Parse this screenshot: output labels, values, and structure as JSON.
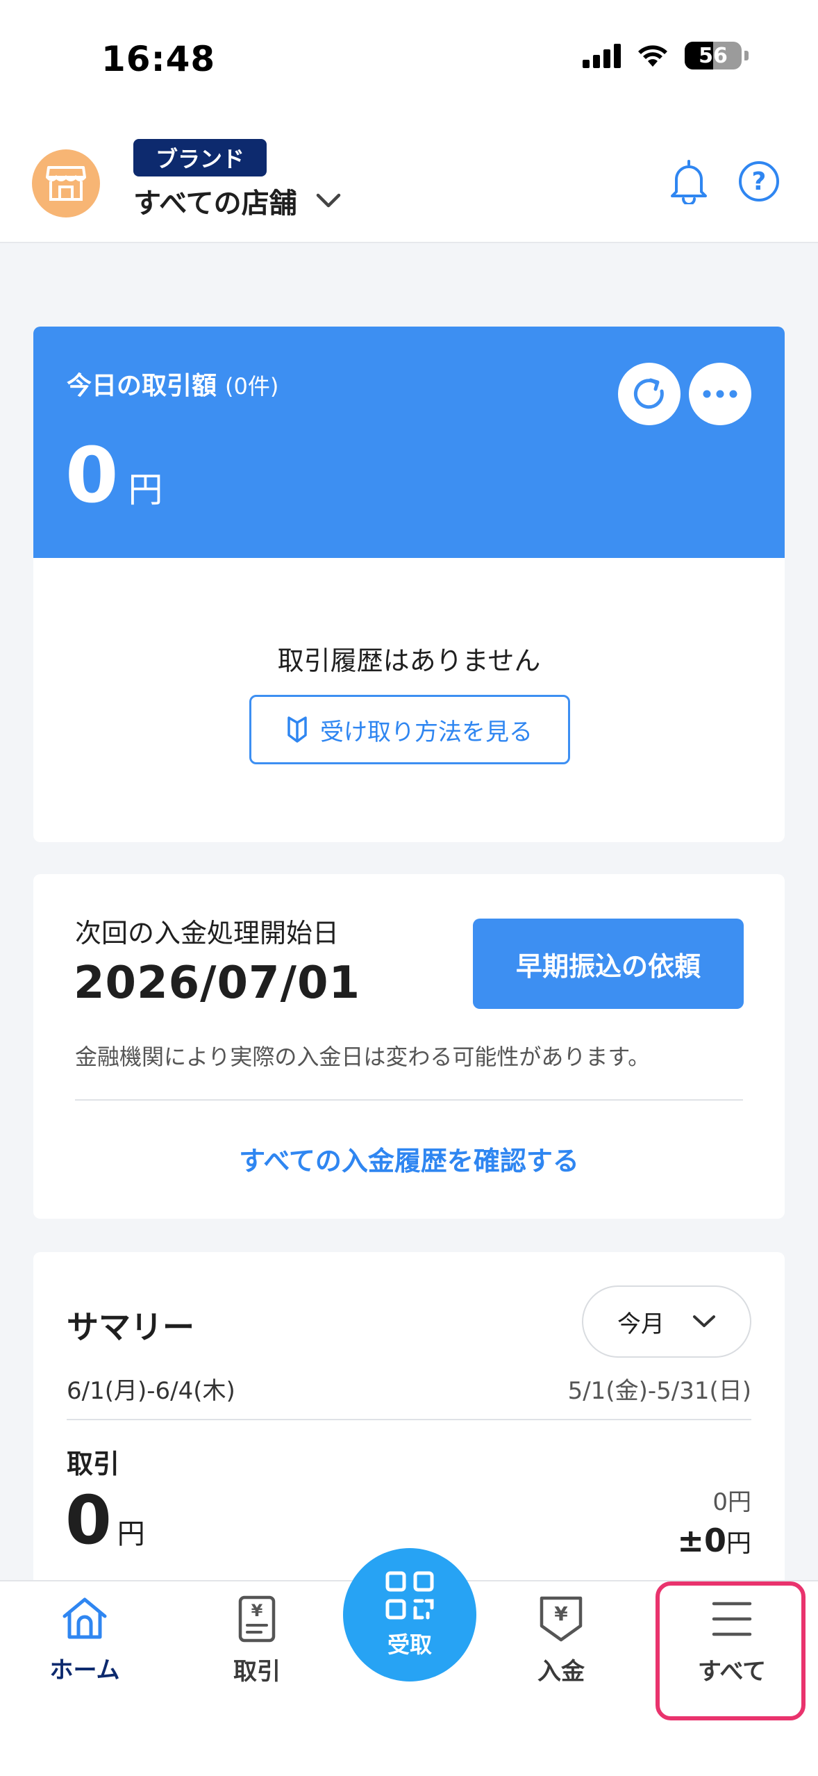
{
  "status_bar": {
    "time": "16:48",
    "battery": "56"
  },
  "header": {
    "brand_badge": "ブランド",
    "store_name": "すべての店舗"
  },
  "today": {
    "title": "今日の取引額",
    "count": "(0件)",
    "amount": "0",
    "unit": "円",
    "empty_message": "取引履歴はありません",
    "howto_label": "受け取り方法を見る"
  },
  "deposit": {
    "label": "次回の入金処理開始日",
    "date": "2026/07/01",
    "early_button": "早期振込の依頼",
    "note": "金融機関により実際の入金日は変わる可能性があります。",
    "history_link": "すべての入金履歴を確認する"
  },
  "summary": {
    "title": "サマリー",
    "period": "今月",
    "range_current": "6/1(月)-6/4(木)",
    "range_previous": "5/1(金)-5/31(日)",
    "txn_label": "取引",
    "txn_amount": "0",
    "txn_unit": "円",
    "txn_previous": "0円",
    "txn_diff_value": "±0",
    "txn_diff_unit": "円"
  },
  "tabbar": {
    "home": "ホーム",
    "transactions": "取引",
    "scan": "受取",
    "deposit": "入金",
    "all": "すべて"
  },
  "colors": {
    "primary": "#3d8ff2",
    "navy": "#0d2a6e",
    "highlight": "#e9336d",
    "avatar": "#f7b574"
  }
}
